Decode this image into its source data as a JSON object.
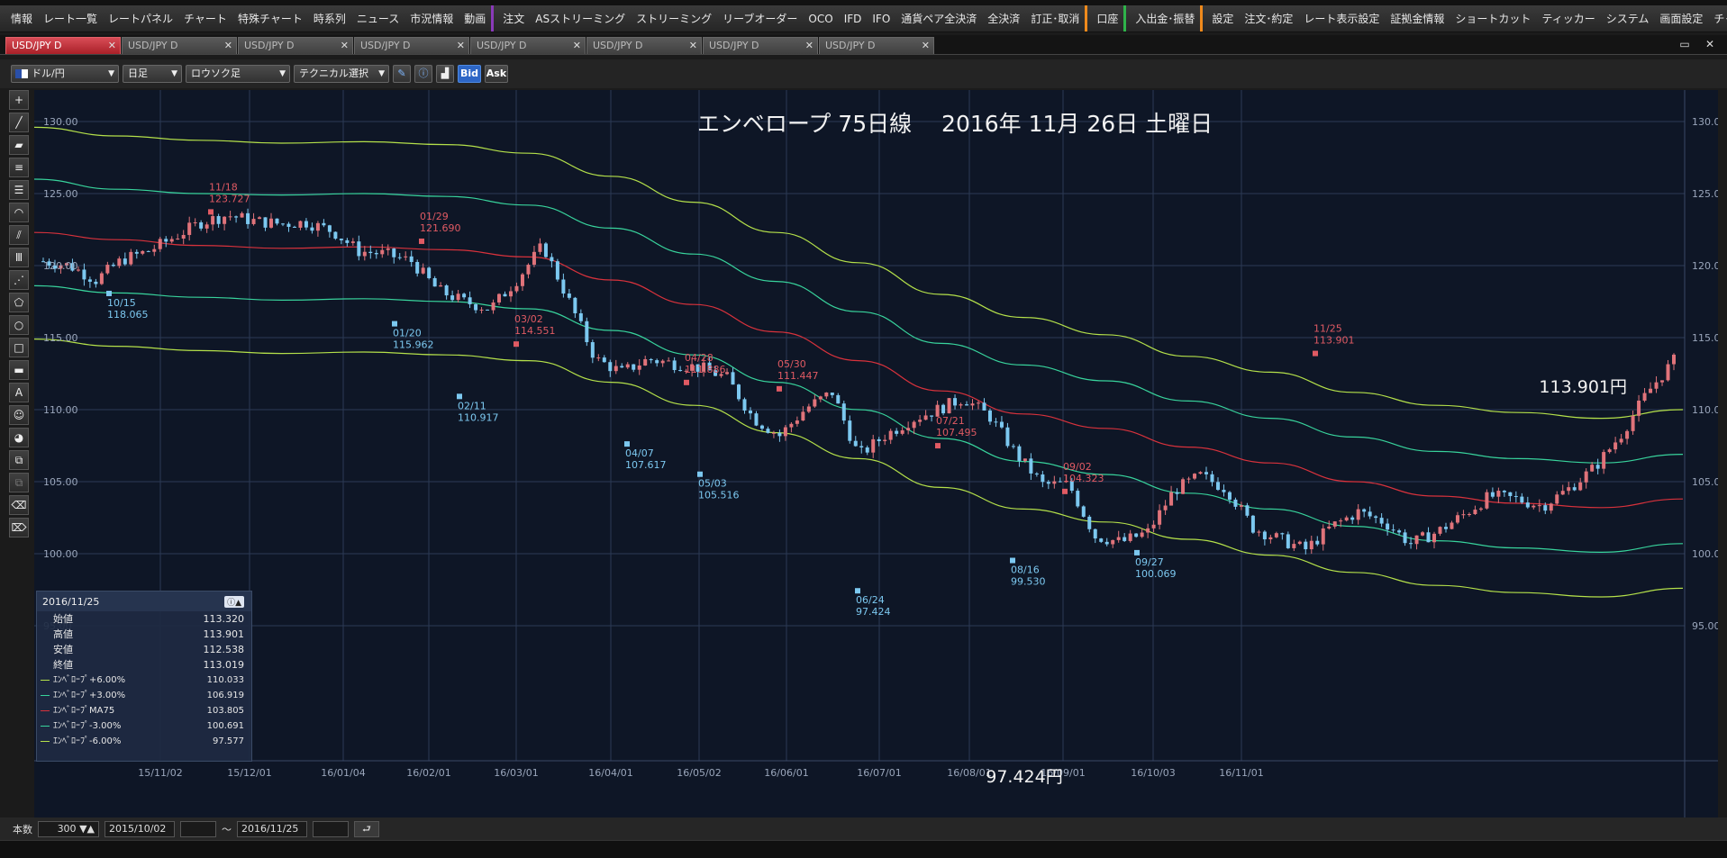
{
  "menu": {
    "items": [
      {
        "label": "情報",
        "g": ""
      },
      {
        "label": "レート一覧",
        "g": ""
      },
      {
        "label": "レートパネル",
        "g": ""
      },
      {
        "label": "チャート",
        "g": ""
      },
      {
        "label": "特殊チャート",
        "g": ""
      },
      {
        "label": "時系列",
        "g": ""
      },
      {
        "label": "ニュース",
        "g": ""
      },
      {
        "label": "市況情報",
        "g": ""
      },
      {
        "label": "動画",
        "g": ""
      },
      {
        "label": "注文",
        "g": "purple"
      },
      {
        "label": "ASストリーミング",
        "g": ""
      },
      {
        "label": "ストリーミング",
        "g": ""
      },
      {
        "label": "リーブオーダー",
        "g": ""
      },
      {
        "label": "OCO",
        "g": ""
      },
      {
        "label": "IFD",
        "g": ""
      },
      {
        "label": "IFO",
        "g": ""
      },
      {
        "label": "通貨ペア全決済",
        "g": ""
      },
      {
        "label": "全決済",
        "g": ""
      },
      {
        "label": "訂正･取消",
        "g": ""
      },
      {
        "label": "口座",
        "g": "orange"
      },
      {
        "label": "入出金･振替",
        "g": "green"
      },
      {
        "label": "設定",
        "g": "orange"
      },
      {
        "label": "注文･約定",
        "g": ""
      },
      {
        "label": "レート表示設定",
        "g": ""
      },
      {
        "label": "証拠金情報",
        "g": ""
      },
      {
        "label": "ショートカット",
        "g": ""
      },
      {
        "label": "ティッカー",
        "g": ""
      },
      {
        "label": "システム",
        "g": ""
      },
      {
        "label": "画面設定",
        "g": ""
      },
      {
        "label": "チャート",
        "g": ""
      }
    ]
  },
  "tabs": [
    "USD/JPY D",
    "USD/JPY D",
    "USD/JPY D",
    "USD/JPY D",
    "USD/JPY D",
    "USD/JPY D",
    "USD/JPY D",
    "USD/JPY D"
  ],
  "toolbar": {
    "pair": "ドル/円",
    "period": "日足",
    "chart_type": "ロウソク足",
    "technical": "テクニカル選択",
    "bid": "Bid",
    "ask": "Ask"
  },
  "chart_title": "エンベロープ 75日線　 2016年 11月 26日 土曜日",
  "chart_data": {
    "type": "candlestick",
    "title": "エンベロープ 75日線　 2016年 11月 26日 土曜日",
    "ylim": [
      95,
      130
    ],
    "y_ticks": [
      "130.00",
      "125.00",
      "120.00",
      "115.00",
      "110.00",
      "105.00",
      "100.00",
      "95.00"
    ],
    "x_ticks": [
      "15/11/02",
      "15/12/01",
      "16/01/04",
      "16/02/01",
      "16/03/01",
      "16/04/01",
      "16/05/02",
      "16/06/01",
      "16/07/01",
      "16/08/01",
      "16/09/01",
      "16/10/03",
      "16/11/01"
    ],
    "series": [
      {
        "name": "エンベロープ+6.00%",
        "color": "#b4e04a",
        "values": [
          129.6,
          129.0,
          128.7,
          128.5,
          128.6,
          128.4,
          127.8,
          126.2,
          124.4,
          122.3,
          120.2,
          118.0,
          116.4,
          115.2,
          113.7,
          112.6,
          111.2,
          110.3,
          109.8,
          109.4,
          110.0
        ]
      },
      {
        "name": "エンベロープ+3.00%",
        "color": "#38d39c",
        "values": [
          126.0,
          125.3,
          125.0,
          124.9,
          125.0,
          124.8,
          124.2,
          122.6,
          120.8,
          118.9,
          116.8,
          114.6,
          113.1,
          112.0,
          110.6,
          109.4,
          108.1,
          107.1,
          106.6,
          106.3,
          106.9
        ]
      },
      {
        "name": "エンベロープMA75",
        "color": "#d8323c",
        "values": [
          122.3,
          121.8,
          121.4,
          121.2,
          121.3,
          121.1,
          120.6,
          119.0,
          117.3,
          115.4,
          113.4,
          111.3,
          109.7,
          108.7,
          107.4,
          106.3,
          105.0,
          104.0,
          103.5,
          103.2,
          103.8
        ]
      },
      {
        "name": "エンベロープ-3.00%",
        "color": "#38d39c",
        "values": [
          118.6,
          118.1,
          117.8,
          117.6,
          117.7,
          117.5,
          117.0,
          115.5,
          113.8,
          111.9,
          110.0,
          108.0,
          106.4,
          105.5,
          104.2,
          103.1,
          101.9,
          100.9,
          100.4,
          100.1,
          100.7
        ]
      },
      {
        "name": "エンベロープ-6.00%",
        "color": "#b4e04a",
        "values": [
          114.9,
          114.4,
          114.1,
          113.9,
          114.0,
          113.8,
          113.4,
          111.9,
          110.3,
          108.4,
          106.6,
          104.6,
          103.1,
          102.2,
          101.0,
          99.9,
          98.7,
          97.8,
          97.3,
          97.0,
          97.6
        ]
      }
    ],
    "candles_close_path": [
      120.3,
      120.0,
      119.0,
      120.4,
      121.0,
      122.0,
      123.0,
      123.5,
      123.1,
      122.9,
      123.0,
      122.4,
      121.0,
      120.8,
      120.3,
      118.3,
      117.5,
      117.0,
      119.0,
      121.4,
      117.5,
      113.5,
      112.6,
      113.5,
      113.2,
      112.9,
      112.2,
      109.4,
      108.2,
      110.1,
      111.2,
      106.8,
      108.2,
      109.3,
      110.0,
      110.8,
      109.5,
      106.9,
      104.8,
      104.8,
      101.2,
      100.8,
      101.5,
      104.4,
      105.4,
      104.5,
      101.8,
      101.0,
      100.3,
      101.9,
      102.9,
      102.2,
      100.7,
      101.5,
      102.7,
      104.0,
      103.8,
      103.3,
      104.5,
      106.0,
      108.3,
      111.2,
      113.4
    ],
    "annotations": [
      {
        "date": "11/18",
        "value": "123.727",
        "kind": "high"
      },
      {
        "date": "10/15",
        "value": "118.065",
        "kind": "low"
      },
      {
        "date": "01/29",
        "value": "121.690",
        "kind": "high"
      },
      {
        "date": "01/20",
        "value": "115.962",
        "kind": "low"
      },
      {
        "date": "03/02",
        "value": "114.551",
        "kind": "high"
      },
      {
        "date": "02/11",
        "value": "110.917",
        "kind": "low"
      },
      {
        "date": "04/28",
        "value": "111.886",
        "kind": "high"
      },
      {
        "date": "04/07",
        "value": "107.617",
        "kind": "low"
      },
      {
        "date": "05/30",
        "value": "111.447",
        "kind": "high"
      },
      {
        "date": "05/03",
        "value": "105.516",
        "kind": "low"
      },
      {
        "date": "07/21",
        "value": "107.495",
        "kind": "high"
      },
      {
        "date": "06/24",
        "value": "97.424",
        "kind": "low"
      },
      {
        "date": "09/02",
        "value": "104.323",
        "kind": "high"
      },
      {
        "date": "08/16",
        "value": "99.530",
        "kind": "low"
      },
      {
        "date": "09/27",
        "value": "100.069",
        "kind": "low"
      },
      {
        "date": "11/25",
        "value": "113.901",
        "kind": "high"
      }
    ],
    "big_high_label": "113.901円",
    "big_low_label": "97.424円"
  },
  "info": {
    "date": "2016/11/25",
    "rows": [
      {
        "label": "始値",
        "value": "113.320"
      },
      {
        "label": "高値",
        "value": "113.901"
      },
      {
        "label": "安値",
        "value": "112.538"
      },
      {
        "label": "終値",
        "value": "113.019"
      }
    ],
    "indicators": [
      {
        "label": "ｴﾝﾍﾞﾛｰﾌﾟ+6.00%",
        "value": "110.033",
        "color": "#b4e04a"
      },
      {
        "label": "ｴﾝﾍﾞﾛｰﾌﾟ+3.00%",
        "value": "106.919",
        "color": "#38d39c"
      },
      {
        "label": "ｴﾝﾍﾞﾛｰﾌﾟMA75",
        "value": "103.805",
        "color": "#d8323c"
      },
      {
        "label": "ｴﾝﾍﾞﾛｰﾌﾟ-3.00%",
        "value": "100.691",
        "color": "#38d39c"
      },
      {
        "label": "ｴﾝﾍﾞﾛｰﾌﾟ-6.00%",
        "value": "97.577",
        "color": "#b4e04a"
      }
    ]
  },
  "bottom": {
    "count_label": "本数",
    "count_value": "300",
    "from_date": "2015/10/02",
    "tilde": "～",
    "to_date": "2016/11/25"
  }
}
